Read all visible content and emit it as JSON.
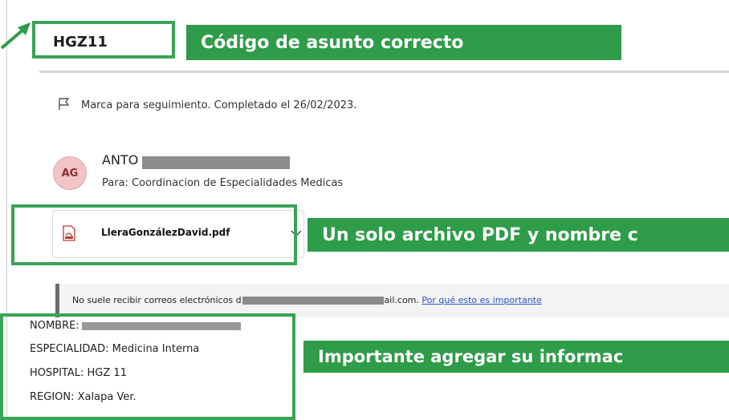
{
  "email": {
    "subject": "HGZ11",
    "flag_text": "Marca para seguimiento. Completado el 26/02/2023.",
    "sender_initials": "AG",
    "sender_name_visible": "ANTO",
    "to_line": "Para:  Coordinacion de Especialidades Medicas",
    "attachment_name": "LleraGonzálezDavid.pdf",
    "warning_prefix": "No suele recibir correos electrónicos d",
    "warning_suffix": "ail.com.",
    "warning_link": "Por qué esto es importante",
    "fields": [
      {
        "label": "NOMBRE:",
        "value": ""
      },
      {
        "label": "ESPECIALIDAD:",
        "value": "Medicina Interna"
      },
      {
        "label": "HOSPITAL:",
        "value": "HGZ 11"
      },
      {
        "label": "REGION:",
        "value": "Xalapa Ver."
      }
    ]
  },
  "annotations": {
    "subject_label": "Código de asunto correcto",
    "attachment_label": "Un solo archivo PDF y nombre c",
    "info_label": "Importante agregar su informac",
    "color": "#2e9c48",
    "frame_color": "#3aa356"
  },
  "icons": [
    "flag-icon",
    "pdf-icon",
    "chevron-down-icon",
    "arrow-icon"
  ]
}
